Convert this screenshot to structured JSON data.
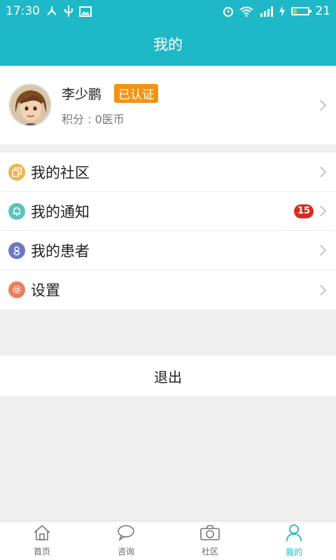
{
  "status_bar": {
    "time": "17:30",
    "battery_level": "21"
  },
  "header": {
    "title": "我的"
  },
  "profile": {
    "name": "李少鹏",
    "verified_label": "已认证",
    "points": "积分 : 0医币"
  },
  "menu": [
    {
      "label": "我的社区",
      "icon": "community-icon",
      "color": "#f0b54a"
    },
    {
      "label": "我的通知",
      "icon": "bell-icon",
      "color": "#5bc4b8",
      "badge": "15"
    },
    {
      "label": "我的患者",
      "icon": "patient-icon",
      "color": "#6b78c4"
    },
    {
      "label": "设置",
      "icon": "gear-icon",
      "color": "#ee7d5b"
    }
  ],
  "logout_label": "退出",
  "tabs": [
    {
      "label": "首页",
      "icon": "home-icon"
    },
    {
      "label": "咨询",
      "icon": "chat-icon"
    },
    {
      "label": "社区",
      "icon": "camera-icon"
    },
    {
      "label": "我的",
      "icon": "person-icon",
      "active": true
    }
  ],
  "colors": {
    "primary": "#1fb8c8",
    "badge": "#d62d20",
    "verified": "#f39313"
  }
}
